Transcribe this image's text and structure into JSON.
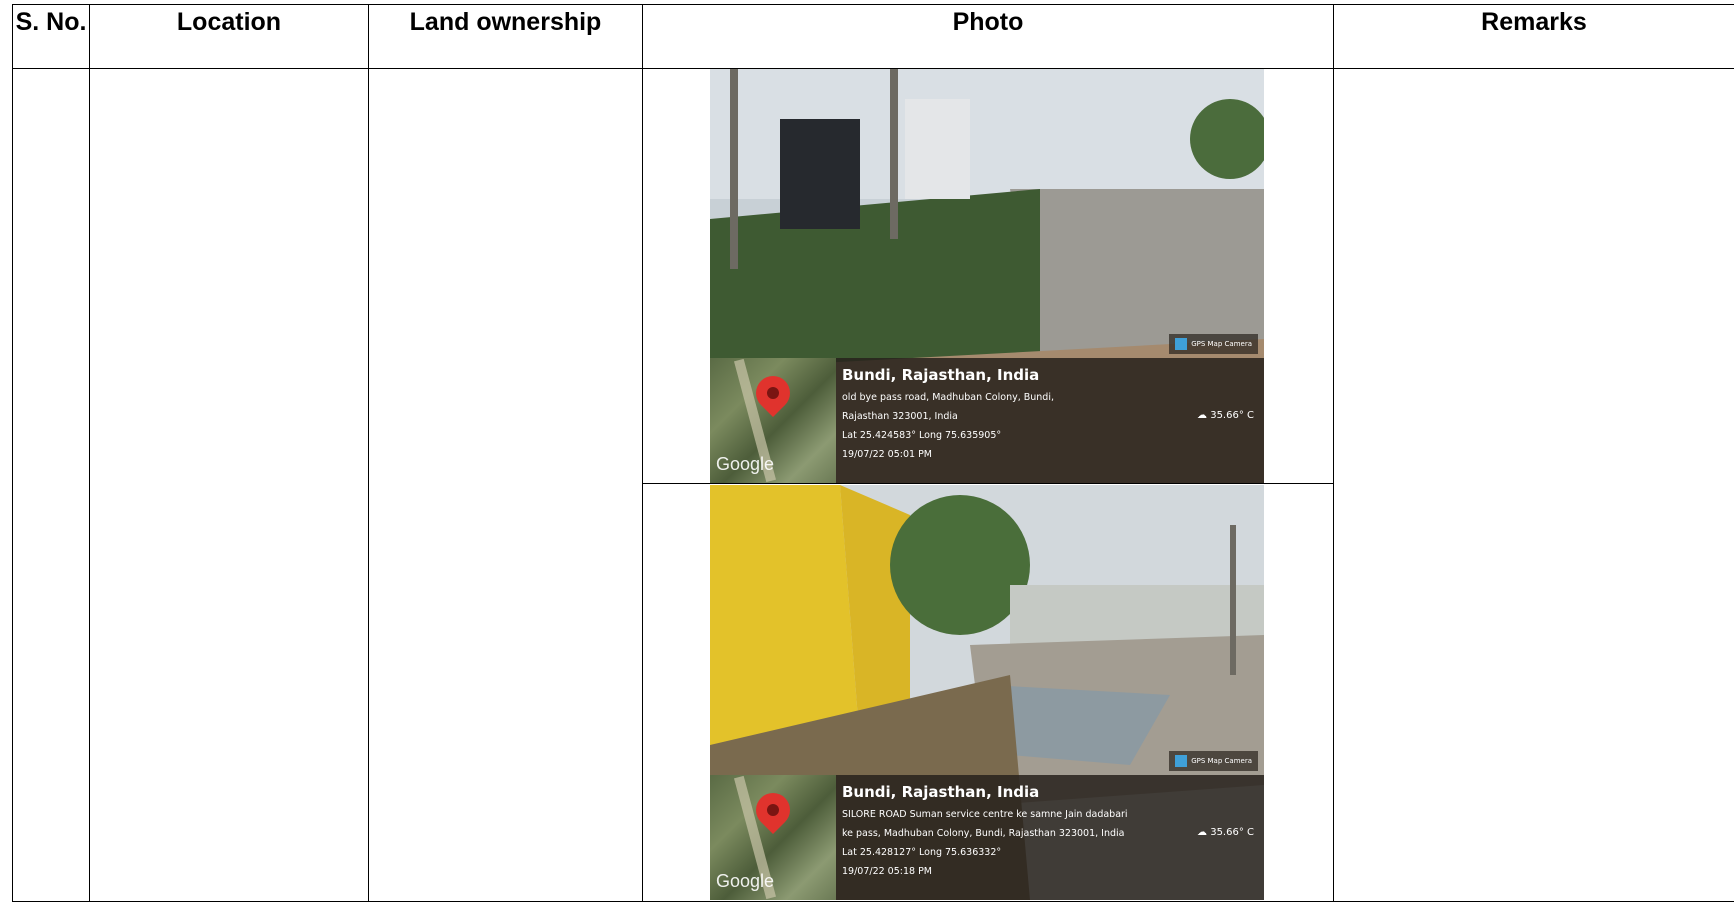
{
  "headers": [
    "S. No.",
    "Location",
    "Land ownership",
    "Photo",
    "Remarks"
  ],
  "photos": [
    {
      "badge": "GPS Map Camera",
      "title": "Bundi, Rajasthan, India",
      "lines": [
        "old bye pass road, Madhuban Colony, Bundi,",
        "Rajasthan 323001, India",
        "Lat 25.424583° Long 75.635905°",
        "19/07/22 05:01 PM"
      ],
      "temperature": "35.66° C",
      "map_label": "Google"
    },
    {
      "badge": "GPS Map Camera",
      "title": "Bundi, Rajasthan, India",
      "lines": [
        "SILORE ROAD Suman service centre ke samne Jain dadabari",
        "ke pass, Madhuban Colony, Bundi, Rajasthan 323001, India",
        "Lat 25.428127° Long 75.636332°",
        "19/07/22 05:18 PM"
      ],
      "temperature": "35.66° C",
      "map_label": "Google"
    }
  ]
}
